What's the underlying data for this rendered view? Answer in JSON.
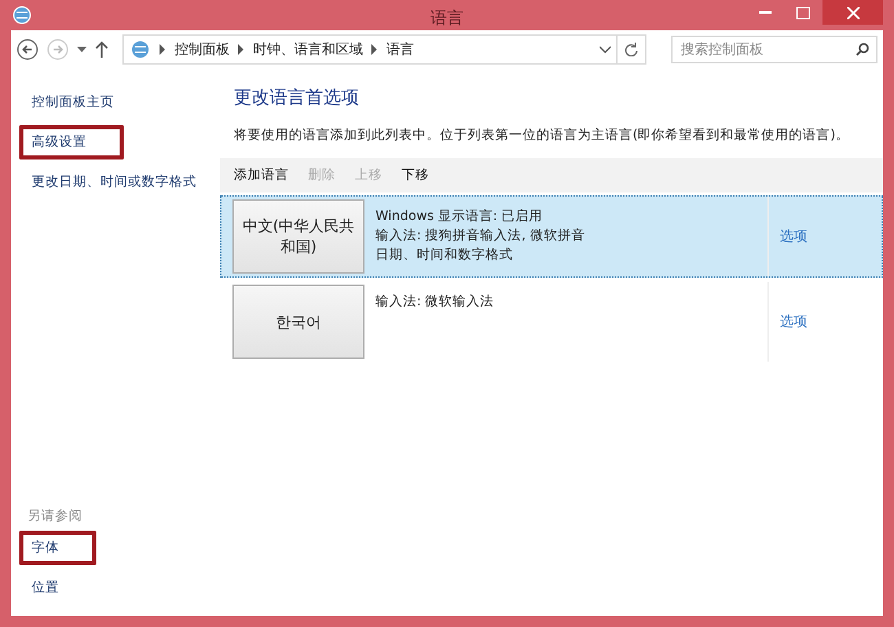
{
  "window": {
    "title": "语言"
  },
  "address_bar": {
    "crumbs": [
      "控制面板",
      "时钟、语言和区域",
      "语言"
    ]
  },
  "search": {
    "placeholder": "搜索控制面板"
  },
  "sidebar": {
    "links": [
      {
        "label": "控制面板主页",
        "highlighted": false
      },
      {
        "label": "高级设置",
        "highlighted": true
      },
      {
        "label": "更改日期、时间或数字格式",
        "highlighted": false
      }
    ],
    "see_also": {
      "heading": "另请参阅",
      "links": [
        {
          "label": "字体",
          "highlighted": true
        },
        {
          "label": "位置",
          "highlighted": false
        }
      ]
    }
  },
  "main": {
    "title": "更改语言首选项",
    "description": "将要使用的语言添加到此列表中。位于列表第一位的语言为主语言(即你希望看到和最常使用的语言)。",
    "toolbar": [
      {
        "label": "添加语言",
        "disabled": false
      },
      {
        "label": "删除",
        "disabled": true
      },
      {
        "label": "上移",
        "disabled": true
      },
      {
        "label": "下移",
        "disabled": false
      }
    ],
    "languages": [
      {
        "name": "中文(中华人民共和国)",
        "details": [
          "Windows 显示语言: 已启用",
          "输入法: 搜狗拼音输入法, 微软拼音",
          "日期、时间和数字格式"
        ],
        "options": "选项",
        "selected": true
      },
      {
        "name": "한국어",
        "details": [
          "输入法: 微软输入法"
        ],
        "options": "选项",
        "selected": false
      }
    ]
  }
}
